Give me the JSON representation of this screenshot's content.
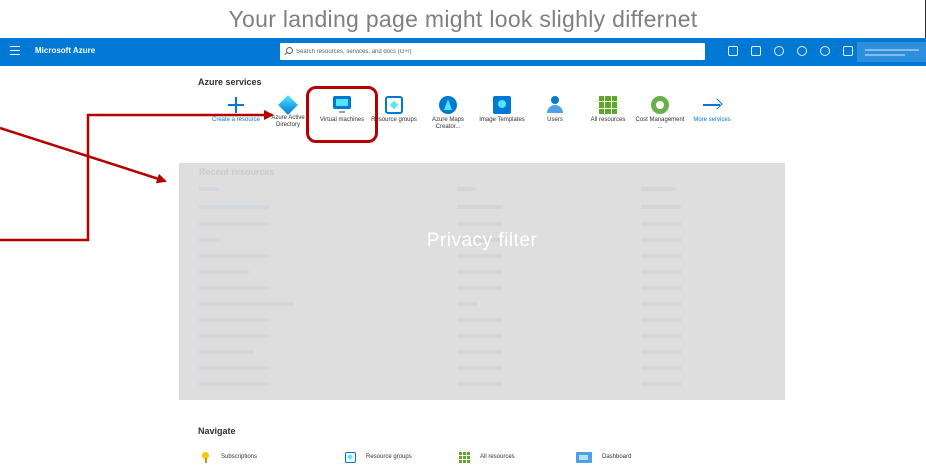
{
  "caption": "Your landing page might look slighly differnet",
  "topbar": {
    "brand": "Microsoft Azure",
    "search_placeholder": "Search resources, services, and docs (G+/)",
    "icons": [
      "cloud-shell-icon",
      "directory-filter-icon",
      "notifications-icon",
      "settings-icon",
      "help-icon",
      "feedback-icon"
    ]
  },
  "services": {
    "title": "Azure services",
    "items": [
      {
        "label": "Create a resource",
        "icon": "plus-icon"
      },
      {
        "label": "Azure Active Directory",
        "icon": "azure-active-directory-icon"
      },
      {
        "label": "Virtual machines",
        "icon": "virtual-machine-icon"
      },
      {
        "label": "Resource groups",
        "icon": "resource-groups-icon"
      },
      {
        "label": "Azure Maps Creator...",
        "icon": "azure-maps-icon"
      },
      {
        "label": "Image Templates",
        "icon": "image-templates-icon"
      },
      {
        "label": "Users",
        "icon": "users-icon"
      },
      {
        "label": "All resources",
        "icon": "all-resources-icon"
      },
      {
        "label": "Cost Management ...",
        "icon": "cost-management-icon"
      },
      {
        "label": "More services",
        "icon": "arrow-right-icon"
      }
    ]
  },
  "recent": {
    "title": "Recent resources",
    "privacy_label": "Privacy filter"
  },
  "navigate": {
    "title": "Navigate",
    "items": [
      {
        "label": "Subscriptions",
        "icon": "key-icon"
      },
      {
        "label": "Resource groups",
        "icon": "resource-groups-icon"
      },
      {
        "label": "All resources",
        "icon": "all-resources-icon"
      },
      {
        "label": "Dashboard",
        "icon": "dashboard-icon"
      }
    ]
  },
  "colors": {
    "topbar": "#0078d4",
    "annotation": "#b40000",
    "privacy_panel": "#dcdcdc"
  }
}
